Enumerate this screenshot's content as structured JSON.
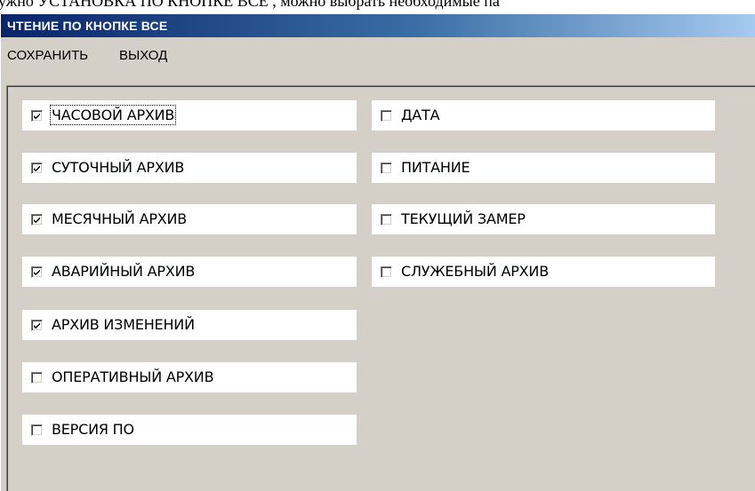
{
  "document_strip": "ужно   УСТАНОВКА ПО КНОПКЕ ВСЕ , можно выбрать необходимые па",
  "window": {
    "title": "ЧТЕНИЕ ПО КНОПКЕ ВСЕ"
  },
  "menu": {
    "items": [
      "СОХРАНИТЬ",
      "ВЫХОД"
    ]
  },
  "checkboxes": {
    "left": [
      {
        "label": "ЧАСОВОЙ АРХИВ",
        "checked": true,
        "focused": true
      },
      {
        "label": "СУТОЧНЫЙ АРХИВ",
        "checked": true
      },
      {
        "label": "МЕСЯЧНЫЙ АРХИВ",
        "checked": true
      },
      {
        "label": "АВАРИЙНЫЙ АРХИВ",
        "checked": true
      },
      {
        "label": "АРХИВ  ИЗМЕНЕНИЙ",
        "checked": true
      },
      {
        "label": "ОПЕРАТИВНЫЙ АРХИВ",
        "checked": false
      },
      {
        "label": "ВЕРСИЯ ПО",
        "checked": false
      }
    ],
    "right": [
      {
        "label": "ДАТА",
        "checked": false
      },
      {
        "label": "ПИТАНИЕ",
        "checked": false
      },
      {
        "label": "ТЕКУЩИЙ ЗАМЕР",
        "checked": false
      },
      {
        "label": "СЛУЖЕБНЫЙ АРХИВ",
        "checked": false
      }
    ]
  },
  "colors": {
    "window_face": "#d4d0c8",
    "title_gradient_start": "#0a246a",
    "title_gradient_end": "#a6caf0",
    "checkbox_row_bg": "#ffffff"
  }
}
